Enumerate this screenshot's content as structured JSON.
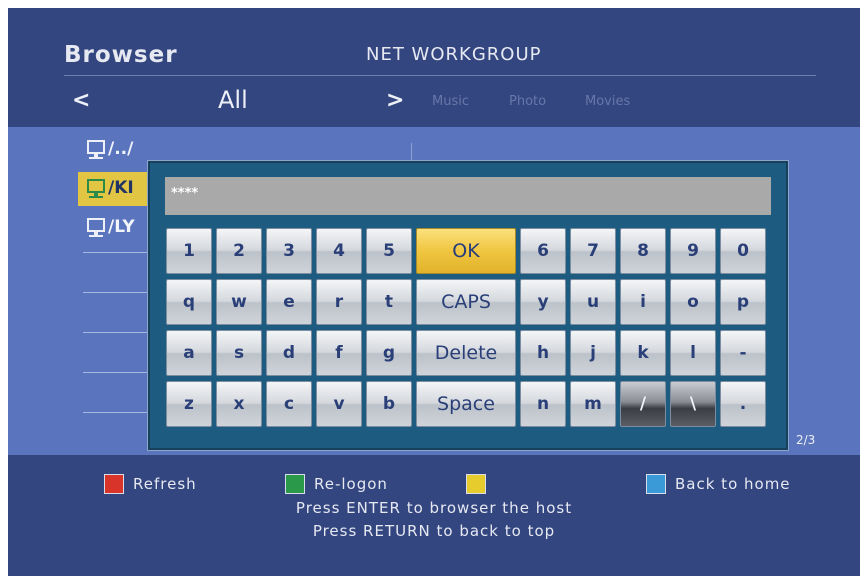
{
  "header": {
    "app_title": "Browser",
    "page_title": "NET WORKGROUP",
    "prev_arrow": "<",
    "current_filter": "All",
    "next_arrow": ">",
    "filters": [
      "Music",
      "Photo",
      "Movies"
    ]
  },
  "file_list": {
    "items": [
      {
        "label": "/../",
        "icon": "network-computer-icon",
        "selected": false
      },
      {
        "label": "/KI",
        "icon": "network-computer-icon",
        "selected": true
      },
      {
        "label": "/LY",
        "icon": "network-computer-icon",
        "selected": false
      }
    ],
    "page_indicator": "2/3"
  },
  "keyboard": {
    "input_value": "****",
    "rows": [
      [
        "1",
        "2",
        "3",
        "4",
        "5",
        "OK",
        "6",
        "7",
        "8",
        "9",
        "0"
      ],
      [
        "q",
        "w",
        "e",
        "r",
        "t",
        "CAPS",
        "y",
        "u",
        "i",
        "o",
        "p"
      ],
      [
        "a",
        "s",
        "d",
        "f",
        "g",
        "Delete",
        "h",
        "j",
        "k",
        "l",
        "-"
      ],
      [
        "z",
        "x",
        "c",
        "v",
        "b",
        "Space",
        "n",
        "m",
        "/",
        "\\",
        "."
      ]
    ],
    "highlighted_key": "OK"
  },
  "footer": {
    "legend": [
      {
        "color": "#d8342a",
        "label": "Refresh",
        "icon": "red-button-icon"
      },
      {
        "color": "#2a9a4a",
        "label": "Re-logon",
        "icon": "green-button-icon"
      },
      {
        "color": "#e6cc2c",
        "label": "",
        "icon": "yellow-button-icon"
      },
      {
        "color": "#3a9ad8",
        "label": "Back to home",
        "icon": "blue-button-icon"
      }
    ],
    "hint_enter": "Press ENTER to browser the host",
    "hint_return": "Press RETURN to back to top"
  }
}
